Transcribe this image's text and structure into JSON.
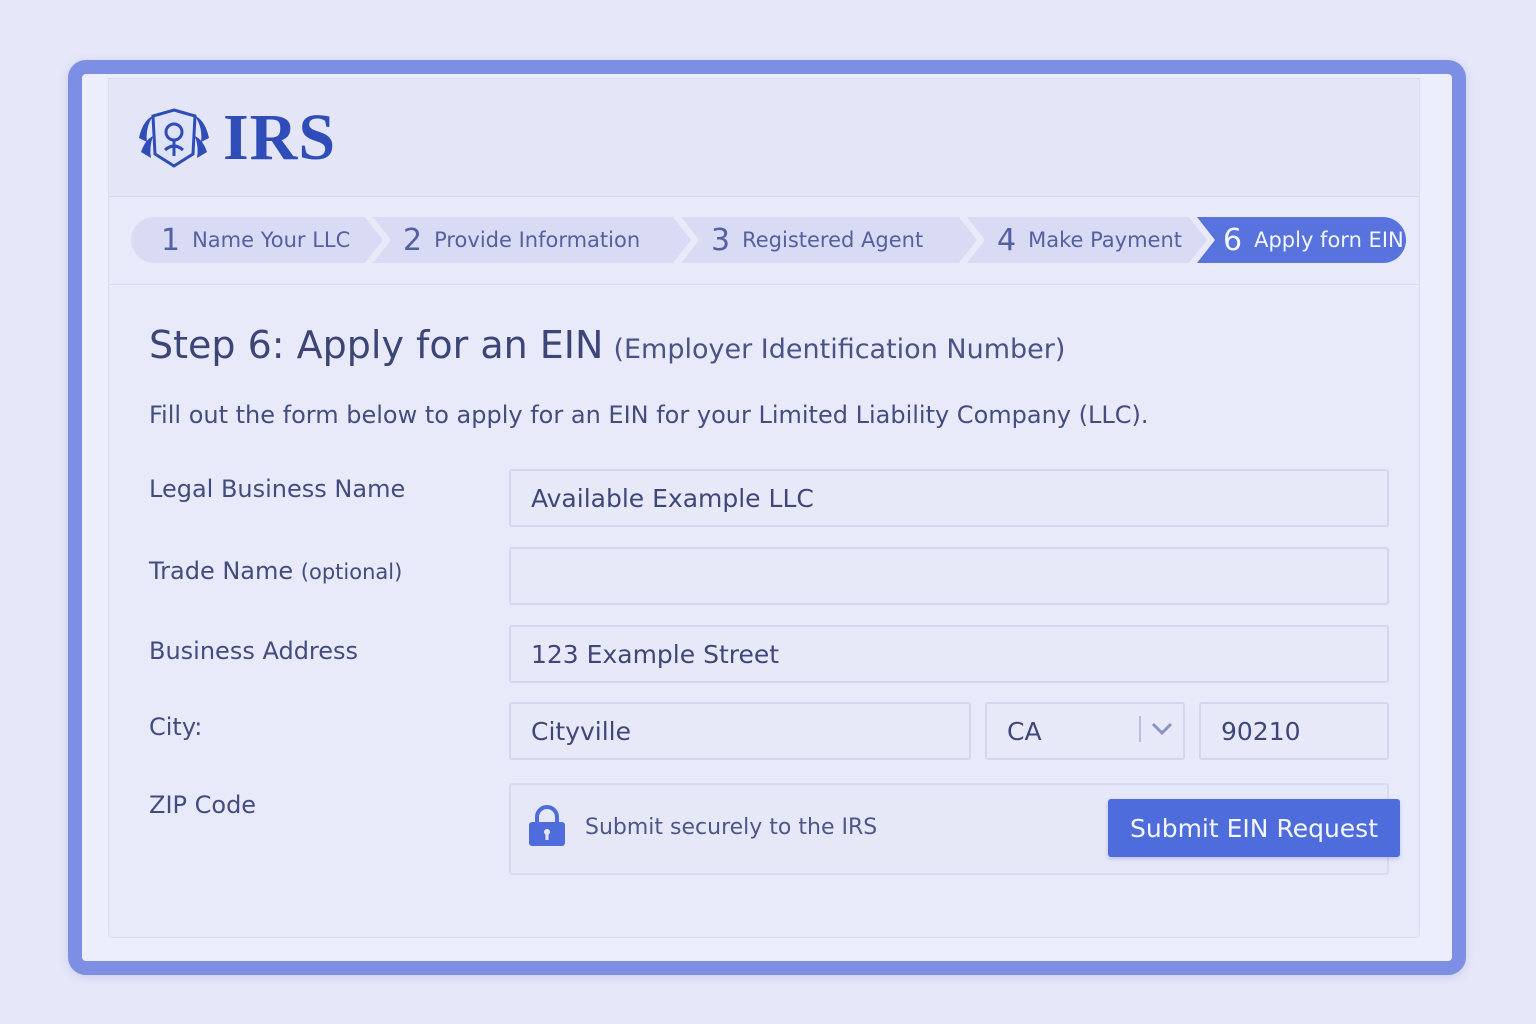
{
  "header": {
    "logo_text": "IRS"
  },
  "steps": [
    {
      "num": "1",
      "label": "Name Your LLC"
    },
    {
      "num": "2",
      "label": "Provide Information"
    },
    {
      "num": "3",
      "label": "Registered Agent"
    },
    {
      "num": "4",
      "label": "Make Payment"
    },
    {
      "num": "6",
      "label": "Apply forn EIN"
    }
  ],
  "page": {
    "title": "Step 6: Apply for an EIN",
    "subtitle": "(Employer Identification Number)",
    "description": "Fill out the form below to apply for an EIN for your Limited Liability Company (LLC)."
  },
  "form": {
    "legal_name_label": "Legal Business Name",
    "legal_name_value": "Available Example LLC",
    "trade_name_label": "Trade Name",
    "trade_name_hint": "(optional)",
    "trade_name_value": "",
    "address_label": "Business Address",
    "address_value": "123 Example Street",
    "city_label": "City:",
    "city_value": "Cityville",
    "state_value": "CA",
    "zip_value": "90210",
    "zip_label": "ZIP Code",
    "secure_text": "Submit securely to the IRS",
    "submit_label": "Submit EIN Request"
  },
  "colors": {
    "accent": "#5873dd",
    "frame": "#7c8fe4",
    "logo": "#2f4db8"
  }
}
